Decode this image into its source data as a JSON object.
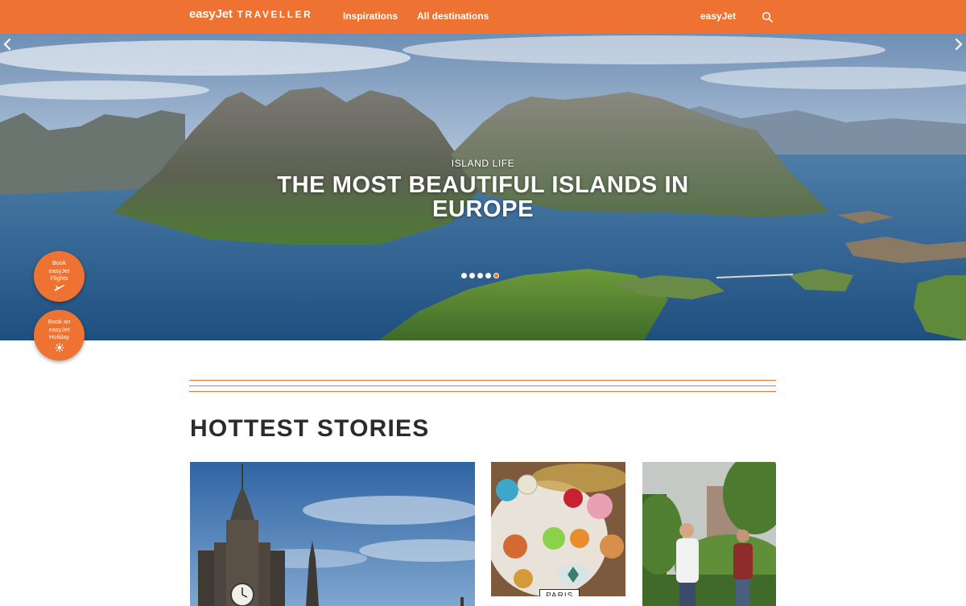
{
  "nav": {
    "brand_logo": "easyJet",
    "brand_sub": "TRAVELLER",
    "links": [
      {
        "label": "Inspirations"
      },
      {
        "label": "All destinations"
      }
    ],
    "easyjet_label": "easyJet",
    "search_icon": "search-icon"
  },
  "hero": {
    "kicker": "ISLAND LIFE",
    "title": "THE MOST BEAUTIFUL ISLANDS IN EUROPE",
    "slides_total": 5,
    "active_slide": 5,
    "prev_icon": "chevron-left-icon",
    "next_icon": "chevron-right-icon"
  },
  "float_buttons": {
    "flights": {
      "line1": "Book",
      "line2": "easyJet",
      "line3": "Flights",
      "icon": "plane-icon"
    },
    "holiday": {
      "line1": "Book an",
      "line2": "easyJet",
      "line3": "Holiday",
      "icon": "sun-icon"
    }
  },
  "section": {
    "title": "HOTTEST STORIES"
  },
  "cards": [
    {
      "image": "edinburgh-clock-tower"
    },
    {
      "image": "cocktails-table",
      "tag": "PARIS"
    },
    {
      "image": "garden-people"
    }
  ],
  "colors": {
    "accent": "#ee7232",
    "text": "#2b2b2b"
  }
}
